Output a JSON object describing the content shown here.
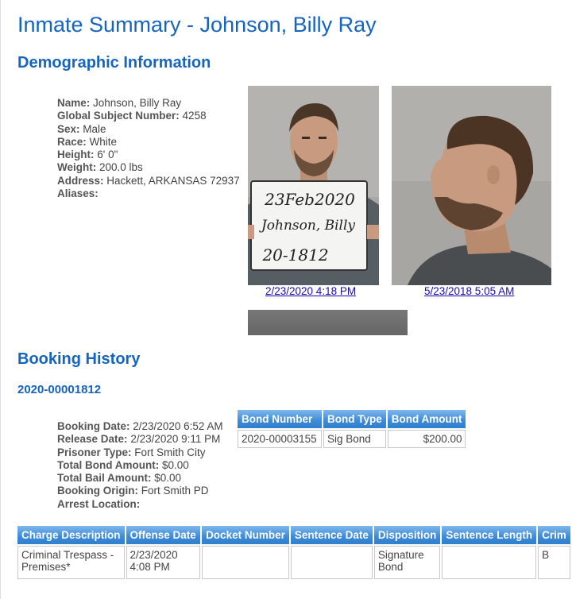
{
  "page": {
    "title": "Inmate Summary - Johnson, Billy Ray"
  },
  "demographic": {
    "heading": "Demographic Information",
    "fields": [
      {
        "label": "Name:",
        "value": "Johnson, Billy Ray"
      },
      {
        "label": "Global Subject Number:",
        "value": "4258"
      },
      {
        "label": "Sex:",
        "value": "Male"
      },
      {
        "label": "Race:",
        "value": "White"
      },
      {
        "label": "Height:",
        "value": "6' 0\""
      },
      {
        "label": "Weight:",
        "value": "200.0 lbs"
      },
      {
        "label": "Address:",
        "value": "Hackett, ARKANSAS 72937"
      },
      {
        "label": "Aliases:",
        "value": ""
      }
    ],
    "photos": [
      {
        "link": "2/23/2020 4:18 PM",
        "sign_lines": [
          "23Feb2020",
          "Johnson, Billy",
          "20-1812"
        ]
      },
      {
        "link": "5/23/2018 5:05 AM"
      }
    ]
  },
  "booking": {
    "heading": "Booking History",
    "number": "2020-00001812",
    "fields": [
      {
        "label": "Booking Date:",
        "value": "2/23/2020 6:52 AM"
      },
      {
        "label": "Release Date:",
        "value": "2/23/2020 9:11 PM"
      },
      {
        "label": "Prisoner Type:",
        "value": "Fort Smith City"
      },
      {
        "label": "Total Bond Amount:",
        "value": "$0.00"
      },
      {
        "label": "Total Bail Amount:",
        "value": "$0.00"
      },
      {
        "label": "Booking Origin:",
        "value": "Fort Smith PD"
      },
      {
        "label": "Arrest Location:",
        "value": ""
      }
    ],
    "bond_table": {
      "headers": [
        "Bond Number",
        "Bond Type",
        "Bond Amount"
      ],
      "rows": [
        [
          "2020-00003155",
          "Sig Bond",
          "$200.00"
        ]
      ]
    },
    "charge_table": {
      "headers": [
        "Charge Description",
        "Offense Date",
        "Docket Number",
        "Sentence Date",
        "Disposition",
        "Sentence Length",
        "Crim"
      ],
      "rows": [
        [
          "Criminal Trespass - Premises*",
          "2/23/2020 4:08 PM",
          "",
          "",
          "Signature Bond",
          "",
          "B"
        ]
      ]
    }
  }
}
